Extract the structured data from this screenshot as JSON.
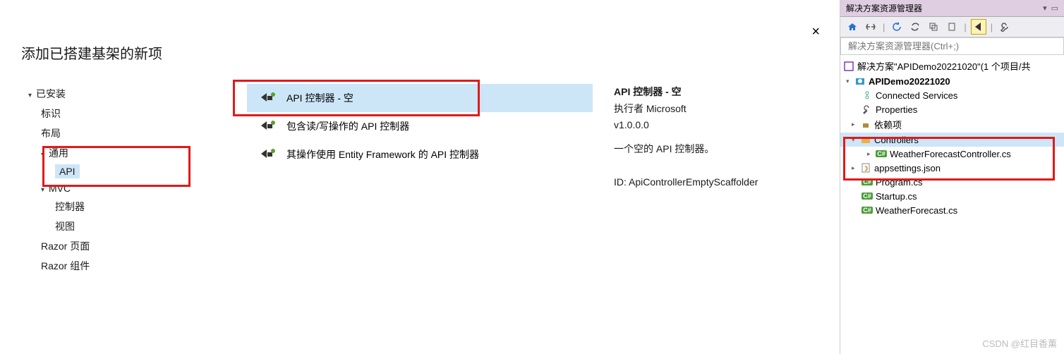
{
  "dialog": {
    "title": "添加已搭建基架的新项",
    "close": "×",
    "tree": {
      "installed": "已安装",
      "identity": "标识",
      "layout": "布局",
      "common": "通用",
      "api": "API",
      "mvc": "MVC",
      "controller": "控制器",
      "view": "视图",
      "razor_page": "Razor 页面",
      "razor_component": "Razor 组件"
    },
    "templates": {
      "api_empty": "API 控制器 - 空",
      "api_rw": "包含读/写操作的 API 控制器",
      "api_ef": "其操作使用 Entity Framework 的 API 控制器"
    },
    "details": {
      "name": "API 控制器 - 空",
      "publisher": "执行者 Microsoft",
      "version": "v1.0.0.0",
      "description": "一个空的 API 控制器。",
      "id": "ID: ApiControllerEmptyScaffolder"
    }
  },
  "solution_explorer": {
    "title": "解决方案资源管理器",
    "search_placeholder": "解决方案资源管理器(Ctrl+;)",
    "solution_label": "解决方案\"APIDemo20221020\"(1 个项目/共",
    "project": "APIDemo20221020",
    "items": {
      "connected_services": "Connected Services",
      "properties": "Properties",
      "dependencies": "依赖项",
      "controllers": "Controllers",
      "weather_controller": "WeatherForecastController.cs",
      "appsettings": "appsettings.json",
      "program": "Program.cs",
      "startup": "Startup.cs",
      "weather_forecast": "WeatherForecast.cs"
    }
  },
  "watermark": "CSDN @红目香薰"
}
